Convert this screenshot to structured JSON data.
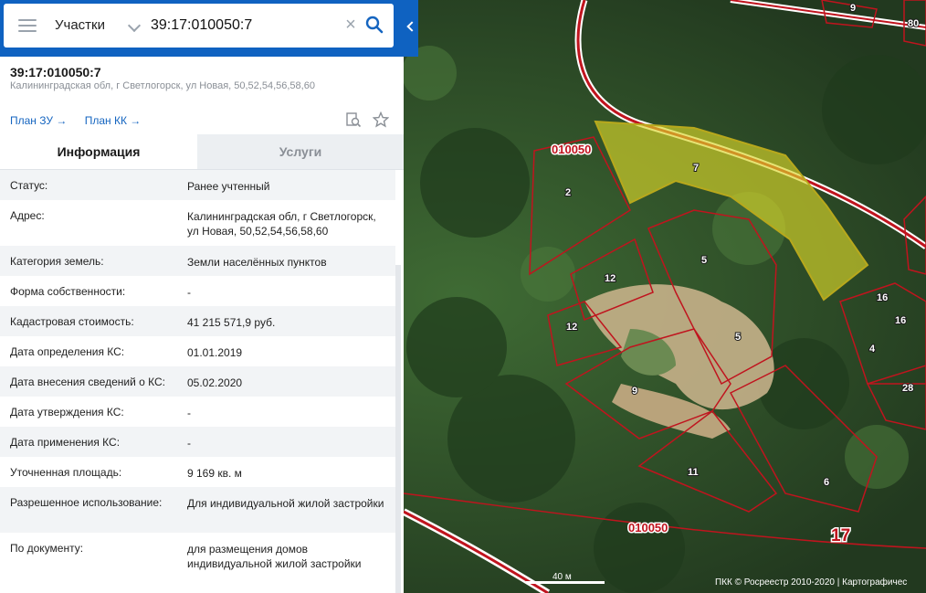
{
  "search": {
    "type_label": "Участки",
    "query": "39:17:010050:7"
  },
  "parcel": {
    "number": "39:17:010050:7",
    "address_line": "Калининградская обл, г Светлогорск, ул Новая, 50,52,54,56,58,60"
  },
  "links": {
    "plan_zu": "План ЗУ →",
    "plan_kk": "План КК →"
  },
  "tabs": {
    "info": "Информация",
    "services": "Услуги"
  },
  "fields": [
    {
      "key": "Статус:",
      "value": "Ранее учтенный"
    },
    {
      "key": "Адрес:",
      "value": "Калининградская обл, г Светлогорск, ул Новая, 50,52,54,56,58,60"
    },
    {
      "key": "Категория земель:",
      "value": "Земли населённых пунктов"
    },
    {
      "key": "Форма собственности:",
      "value": "-"
    },
    {
      "key": "Кадастровая стоимость:",
      "value": "41 215 571,9 руб."
    },
    {
      "key": "Дата определения КС:",
      "value": "01.01.2019"
    },
    {
      "key": "Дата внесения сведений о КС:",
      "value": "05.02.2020"
    },
    {
      "key": "Дата утверждения КС:",
      "value": "-"
    },
    {
      "key": "Дата применения КС:",
      "value": "-"
    },
    {
      "key": "Уточненная площадь:",
      "value": "9 169 кв. м"
    },
    {
      "key": "Разрешенное использование:",
      "value": "Для индивидуальной жилой застройки"
    },
    {
      "key": "По документу:",
      "value": "для размещения домов индивидуальной жилой застройки"
    }
  ],
  "map": {
    "quarter_labels": [
      "010050",
      "010050"
    ],
    "parcel_labels": [
      "7",
      "2",
      "5",
      "12",
      "12",
      "5",
      "9",
      "11",
      "6",
      "16",
      "16",
      "4",
      "28",
      "9",
      "80",
      "17"
    ],
    "scale_label": "40 м",
    "attribution": "ПКК © Росреестр 2010-2020 | Картографичес",
    "colors": {
      "selected_fill": "#d9d62a",
      "boundary": "#c0141e",
      "forest": "#2c4a26"
    }
  },
  "icons": [
    "menu-icon",
    "chevron-down-icon",
    "clear-icon",
    "search-icon",
    "chevron-left-icon",
    "print-preview-icon",
    "star-icon"
  ]
}
